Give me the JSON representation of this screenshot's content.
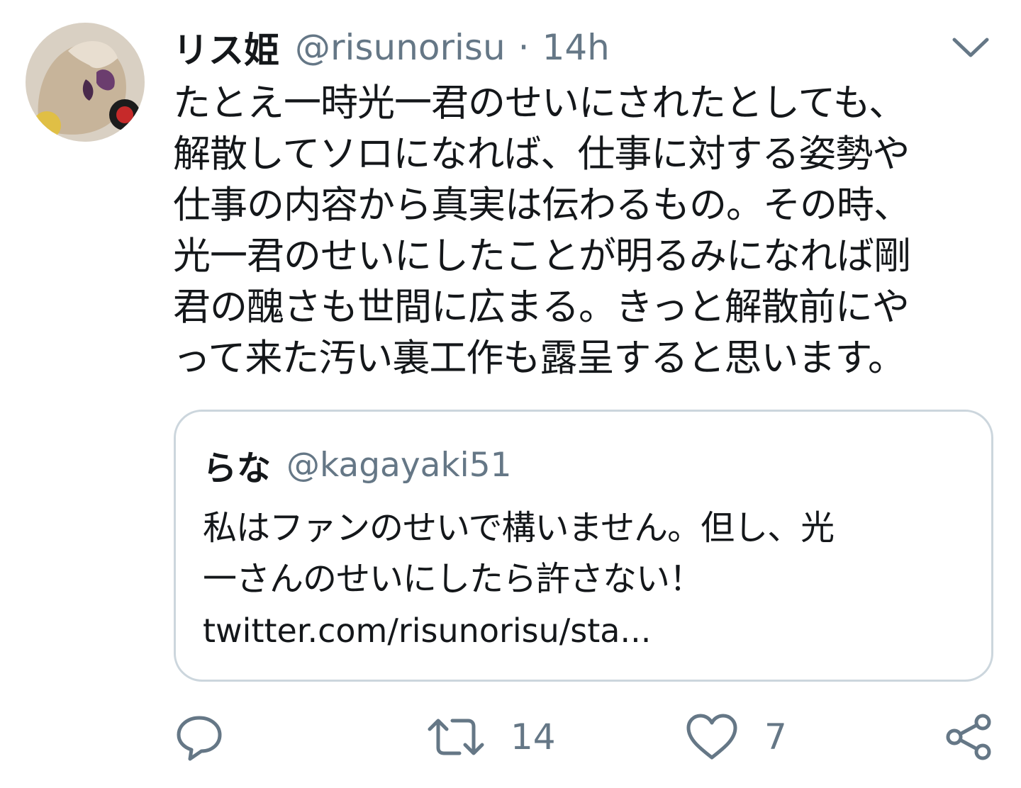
{
  "author": {
    "display_name": "リス姫",
    "handle": "@risunorisu",
    "separator": "·",
    "time": "14h"
  },
  "tweet": {
    "lines": [
      "たとえ一時光一君のせいにされたとしても、",
      "解散してソロになれば、仕事に対する姿勢や",
      "仕事の内容から真実は伝わるもの。その時、",
      "光一君のせいにしたことが明るみになれば剛",
      "君の醜さも世間に広まる。きっと解散前にや",
      "って来た汚い裏工作も露呈すると思います。"
    ]
  },
  "quoted_tweet": {
    "display_name": "らな",
    "handle": "@kagayaki51",
    "lines": [
      "私はファンのせいで構いません。但し、光",
      "一さんのせいにしたら許さない！"
    ],
    "link": "twitter.com/risunorisu/sta..."
  },
  "actions": {
    "reply_count": "",
    "retweet_count": "14",
    "like_count": "7"
  },
  "colors": {
    "text": "#14171a",
    "secondary": "#657786",
    "border": "#ccd6dd"
  },
  "icons": {
    "menu": "chevron-down-icon",
    "reply": "reply-icon",
    "retweet": "retweet-icon",
    "like": "heart-icon",
    "share": "share-icon"
  }
}
